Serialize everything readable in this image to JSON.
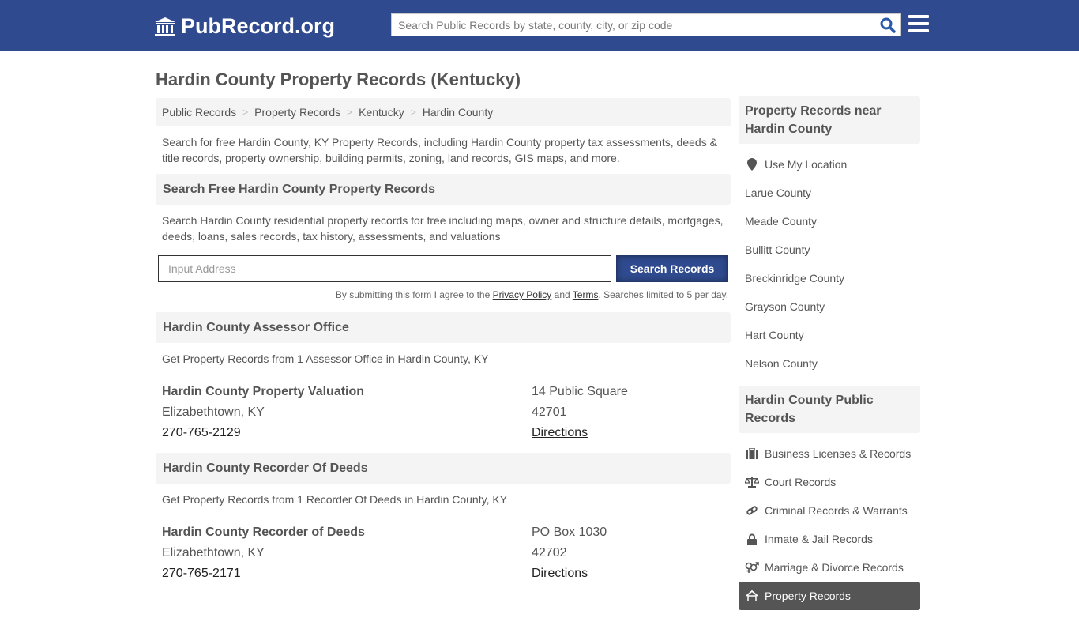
{
  "header": {
    "logo_text": "PubRecord.org",
    "search_placeholder": "Search Public Records by state, county, city, or zip code"
  },
  "page_title": "Hardin County Property Records (Kentucky)",
  "breadcrumb": [
    "Public Records",
    "Property Records",
    "Kentucky",
    "Hardin County"
  ],
  "intro": "Search for free Hardin County, KY Property Records, including Hardin County property tax assessments, deeds & title records, property ownership, building permits, zoning, land records, GIS maps, and more.",
  "search_section": {
    "heading": "Search Free Hardin County Property Records",
    "description": "Search Hardin County residential property records for free including maps, owner and structure details, mortgages, deeds, loans, sales records, tax history, assessments, and valuations",
    "input_placeholder": "Input Address",
    "button_label": "Search Records",
    "terms_prefix": "By submitting this form I agree to the ",
    "privacy_label": "Privacy Policy",
    "terms_and": " and ",
    "terms_label": "Terms",
    "terms_suffix": ". Searches limited to 5 per day."
  },
  "sections": [
    {
      "heading": "Hardin County Assessor Office",
      "summary": "Get Property Records from 1 Assessor Office in Hardin County, KY",
      "office": {
        "name": "Hardin County Property Valuation",
        "city": "Elizabethtown, KY",
        "phone": "270-765-2129",
        "address": "14 Public Square",
        "zip": "42701",
        "directions": "Directions"
      }
    },
    {
      "heading": "Hardin County Recorder Of Deeds",
      "summary": "Get Property Records from 1 Recorder Of Deeds in Hardin County, KY",
      "office": {
        "name": "Hardin County Recorder of Deeds",
        "city": "Elizabethtown, KY",
        "phone": "270-765-2171",
        "address": "PO Box 1030",
        "zip": "42702",
        "directions": "Directions"
      }
    }
  ],
  "sidebar": {
    "nearby_heading": "Property Records near Hardin County",
    "use_location": "Use My Location",
    "nearby": [
      "Larue County",
      "Meade County",
      "Bullitt County",
      "Breckinridge County",
      "Grayson County",
      "Hart County",
      "Nelson County"
    ],
    "public_heading": "Hardin County Public Records",
    "public_items": [
      {
        "label": "Business Licenses & Records",
        "icon": "briefcase-icon"
      },
      {
        "label": "Court Records",
        "icon": "scale-icon"
      },
      {
        "label": "Criminal Records & Warrants",
        "icon": "link-icon"
      },
      {
        "label": "Inmate & Jail Records",
        "icon": "lock-icon"
      },
      {
        "label": "Marriage & Divorce Records",
        "icon": "gender-icon"
      },
      {
        "label": "Property Records",
        "icon": "home-icon",
        "active": true
      }
    ]
  }
}
